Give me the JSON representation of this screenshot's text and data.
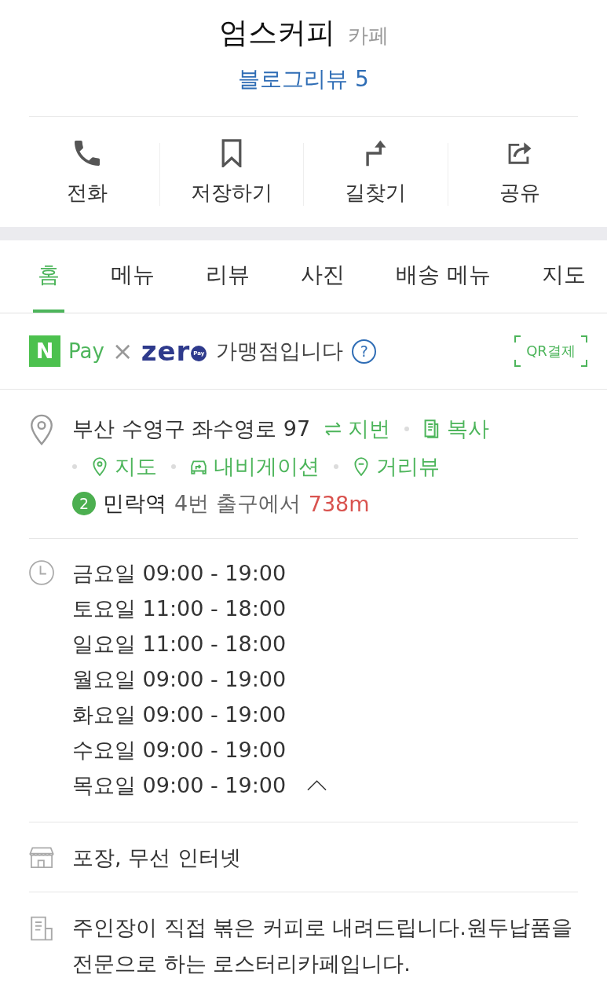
{
  "header": {
    "name": "엄스커피",
    "category": "카페",
    "blog_review": "블로그리뷰 5"
  },
  "actions": [
    {
      "label": "전화",
      "kind": "phone"
    },
    {
      "label": "저장하기",
      "kind": "bookmark"
    },
    {
      "label": "길찾기",
      "kind": "directions"
    },
    {
      "label": "공유",
      "kind": "share"
    }
  ],
  "tabs": [
    {
      "label": "홈",
      "selected": true
    },
    {
      "label": "메뉴",
      "selected": false
    },
    {
      "label": "리뷰",
      "selected": false
    },
    {
      "label": "사진",
      "selected": false
    },
    {
      "label": "배송 메뉴",
      "selected": false
    },
    {
      "label": "지도",
      "selected": false
    }
  ],
  "payment": {
    "npay_mark": "N",
    "npay_text": "Pay",
    "separator": "×",
    "zero_text": "zer",
    "zero_badge": "Pay",
    "text": "가맹점입니다",
    "help": "?",
    "qr_button": "QR결제"
  },
  "address": {
    "text": "부산 수영구 좌수영로 97",
    "links": [
      {
        "label": "지번",
        "kind": "swap"
      },
      {
        "label": "복사",
        "kind": "copy"
      }
    ],
    "more_links": [
      {
        "label": "지도",
        "kind": "map"
      },
      {
        "label": "내비게이션",
        "kind": "navigation"
      },
      {
        "label": "거리뷰",
        "kind": "streetview"
      }
    ],
    "station": {
      "line": "2",
      "name": "민락역",
      "exit": "4번 출구에서",
      "distance": "738m"
    }
  },
  "hours": {
    "expanded": true,
    "lines": [
      "금요일 09:00 - 19:00",
      "토요일 11:00 - 18:00",
      "일요일 11:00 - 18:00",
      "월요일 09:00 - 19:00",
      "화요일 09:00 - 19:00",
      "수요일 09:00 - 19:00",
      "목요일 09:00 - 19:00"
    ]
  },
  "amenities": "포장, 무선 인터넷",
  "description": "주인장이 직접 볶은 커피로 내려드립니다.원두납품을 전문으로 하는 로스터리카페입니다."
}
